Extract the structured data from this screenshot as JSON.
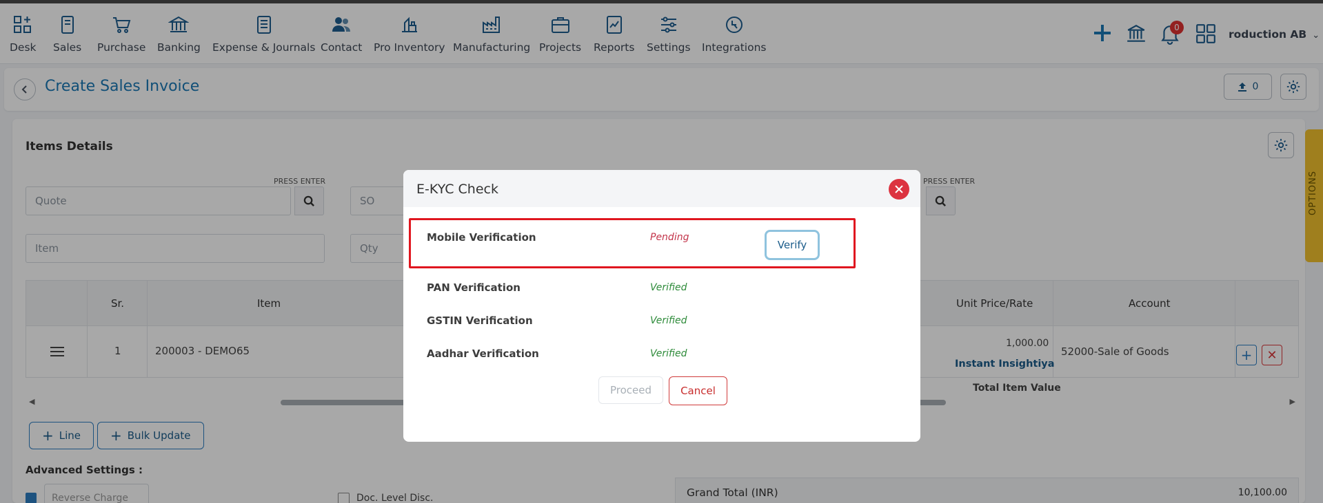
{
  "nav": {
    "items": [
      {
        "label": "Desk",
        "icon": "desk-icon"
      },
      {
        "label": "Sales",
        "icon": "sales-icon"
      },
      {
        "label": "Purchase",
        "icon": "cart-icon"
      },
      {
        "label": "Banking",
        "icon": "bank-icon"
      },
      {
        "label": "Expense & Journals",
        "icon": "journal-icon"
      },
      {
        "label": "Contact",
        "icon": "contact-icon"
      },
      {
        "label": "Pro Inventory",
        "icon": "inventory-icon"
      },
      {
        "label": "Manufacturing",
        "icon": "factory-icon"
      },
      {
        "label": "Projects",
        "icon": "projects-icon"
      },
      {
        "label": "Reports",
        "icon": "reports-icon"
      },
      {
        "label": "Settings",
        "icon": "sliders-icon"
      },
      {
        "label": "Integrations",
        "icon": "integrations-icon"
      }
    ],
    "notification_count": "0",
    "user_name": "roduction AB",
    "user_chevron": "⌄"
  },
  "page": {
    "title": "Create Sales Invoice",
    "upload_count": "0"
  },
  "items_details": {
    "title": "Items Details",
    "press_enter": "PRESS ENTER",
    "quote_placeholder": "Quote",
    "so_placeholder": "SO",
    "item_placeholder": "Item",
    "qty_placeholder": "Qty"
  },
  "table": {
    "headers": {
      "sr": "Sr.",
      "item": "Item",
      "unit_price": "Unit Price/Rate",
      "account": "Account"
    },
    "row": {
      "sr": "1",
      "item": "200003 - DEMO65",
      "unit_price": "1,000.00",
      "link": "Instant Insightiya",
      "account": "52000-Sale of Goods"
    },
    "total_label": "Total Item Value"
  },
  "actions": {
    "line": "Line",
    "bulk_update": "Bulk Update"
  },
  "advanced": {
    "title": "Advanced Settings :",
    "reverse_charge": "Reverse Charge",
    "doc_level_disc": "Doc. Level Disc.",
    "grand_total_label": "Grand Total (INR)",
    "grand_total_value": "10,100.00"
  },
  "options_tab": "OPTIONS",
  "modal": {
    "title": "E-KYC Check",
    "rows": [
      {
        "label": "Mobile Verification",
        "status": "Pending"
      },
      {
        "label": "PAN Verification",
        "status": "Verified"
      },
      {
        "label": "GSTIN Verification",
        "status": "Verified"
      },
      {
        "label": "Aadhar Verification",
        "status": "Verified"
      }
    ],
    "verify": "Verify",
    "proceed": "Proceed",
    "cancel": "Cancel"
  },
  "colors": {
    "brand_blue": "#1b78b5",
    "danger": "#dc3340",
    "verified": "#2e8b3a",
    "pending": "#c3344a",
    "options_tab": "#f2c12e"
  }
}
